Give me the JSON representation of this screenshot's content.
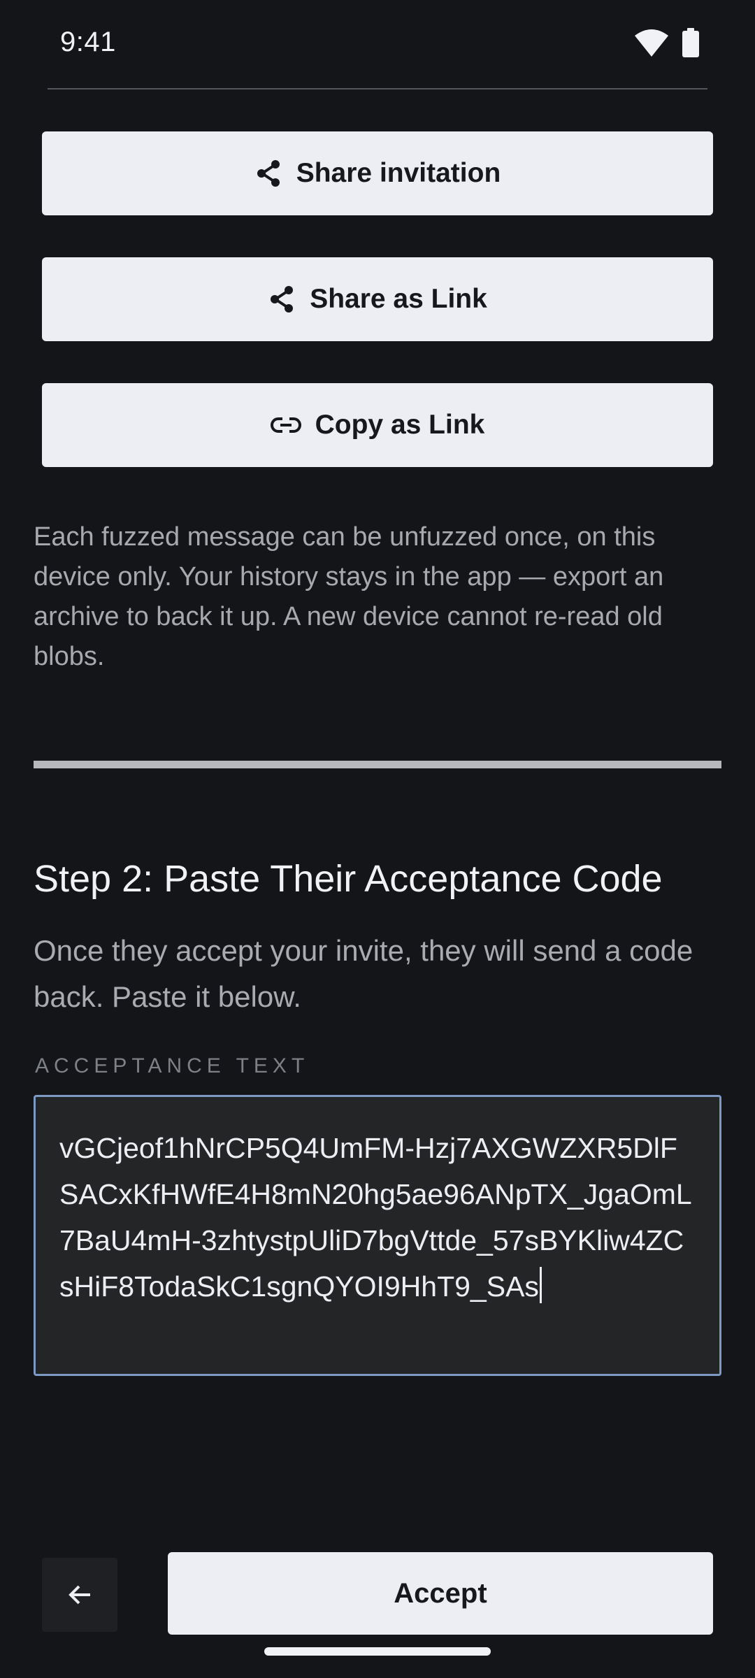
{
  "status_bar": {
    "time": "9:41",
    "icons": [
      "wifi-icon",
      "battery-icon"
    ]
  },
  "share_actions": [
    {
      "label": "Share invitation",
      "icon": "share-icon"
    },
    {
      "label": "Share as Link",
      "icon": "share-icon"
    },
    {
      "label": "Copy as Link",
      "icon": "link-icon"
    }
  ],
  "info_text": "Each fuzzed message can be unfuzzed once, on this device only. Your history stays in the app — export an archive to back it up. A new device cannot re-read old blobs.",
  "step2": {
    "title": "Step 2: Paste Their Acceptance Code",
    "description": "Once they accept your invite, they will send a code back. Paste it below.",
    "field_label": "ACCEPTANCE TEXT",
    "field_value": "vGCjeof1hNrCP5Q4UmFM-Hzj7AXGWZXR5DlFSACxKfHWfE4H8mN20hg5ae96ANpTX_JgaOmL7BaU4mH-3zhtystpUliD7bgVttde_57sBYKliw4ZCsHiF8TodaSkC1sgnQYOI9HhT9_SAs"
  },
  "bottom_bar": {
    "back_icon": "arrow-left-icon",
    "accept_label": "Accept"
  },
  "colors": {
    "background": "#141519",
    "button_bg": "#eceef3",
    "field_border": "#7d9ac4"
  }
}
